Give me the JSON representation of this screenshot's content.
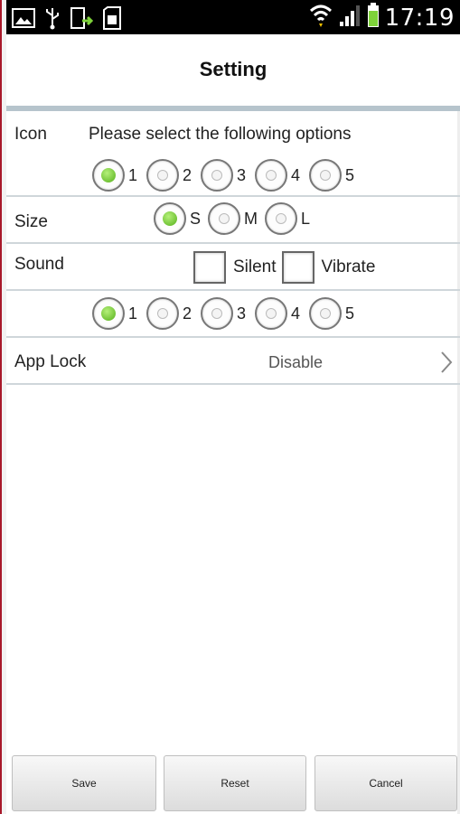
{
  "status_bar": {
    "time": "17:19",
    "left_icons": [
      "image-icon",
      "usb-icon",
      "phone-upload-icon",
      "sd-card-icon"
    ],
    "right_icons": [
      "wifi-icon",
      "signal-icon",
      "battery-icon"
    ]
  },
  "header": {
    "title": "Setting"
  },
  "icon_row": {
    "label": "Icon",
    "prompt": "Please select the following options",
    "options": [
      "1",
      "2",
      "3",
      "4",
      "5"
    ],
    "selected": "1"
  },
  "size_row": {
    "label": "Size",
    "options": [
      "S",
      "M",
      "L"
    ],
    "selected": "S"
  },
  "sound_row": {
    "label": "Sound",
    "checkboxes": [
      "Silent",
      "Vibrate"
    ],
    "options": [
      "1",
      "2",
      "3",
      "4",
      "5"
    ],
    "selected": "1"
  },
  "app_lock": {
    "label": "App Lock",
    "value": "Disable"
  },
  "footer": {
    "save": "Save",
    "reset": "Reset",
    "cancel": "Cancel"
  },
  "colors": {
    "accent_green": "#55b01a",
    "divider": "#cfd6da",
    "title_line": "#b6c4cc"
  }
}
